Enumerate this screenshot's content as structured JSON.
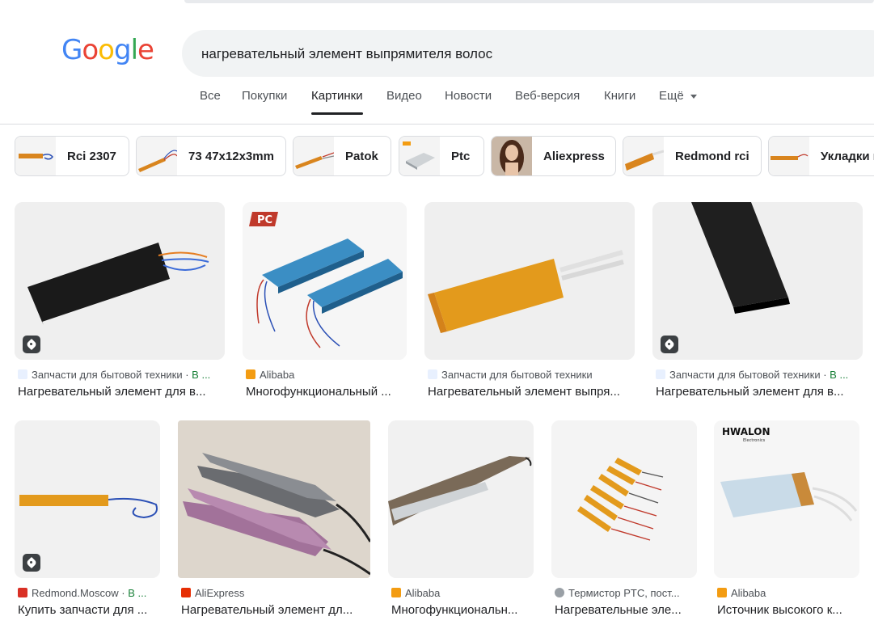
{
  "search": {
    "query": "нагревательный элемент выпрямителя волос"
  },
  "logo": {
    "letters": [
      "G",
      "o",
      "o",
      "g",
      "l",
      "e"
    ],
    "colors": [
      "#4285F4",
      "#EA4335",
      "#FBBC05",
      "#4285F4",
      "#34A853",
      "#EA4335"
    ]
  },
  "tabs": [
    {
      "label": "Все"
    },
    {
      "label": "Покупки"
    },
    {
      "label": "Картинки"
    },
    {
      "label": "Видео"
    },
    {
      "label": "Новости"
    },
    {
      "label": "Веб-версия"
    },
    {
      "label": "Книги"
    },
    {
      "label": "Ещё"
    }
  ],
  "chips": [
    {
      "label": "Rci 2307"
    },
    {
      "label": "73 47x12x3mm"
    },
    {
      "label": "Patok"
    },
    {
      "label": "Ptc"
    },
    {
      "label": "Aliexpress"
    },
    {
      "label": "Redmond rci"
    },
    {
      "label": "Укладки в"
    }
  ],
  "results": [
    {
      "source": "Запчасти для бытовой техники · ",
      "source_extra": "В ...",
      "title": "Нагревательный элемент для в...",
      "favicon": "zip-icon",
      "product_tag": true
    },
    {
      "source": "Alibaba",
      "source_extra": "",
      "title": "Многофункциональный ...",
      "favicon": "alibaba-icon",
      "product_tag": false
    },
    {
      "source": "Запчасти для бытовой техники",
      "source_extra": "",
      "title": "Нагревательный элемент выпря...",
      "favicon": "zip-icon",
      "product_tag": false
    },
    {
      "source": "Запчасти для бытовой техники · ",
      "source_extra": "В ...",
      "title": "Нагревательный элемент для в...",
      "favicon": "zip-icon",
      "product_tag": true
    },
    {
      "source": "Redmond.Moscow · ",
      "source_extra": "В ...",
      "title": "Купить запчасти для ...",
      "favicon": "redmond-icon",
      "product_tag": true
    },
    {
      "source": "AliExpress",
      "source_extra": "",
      "title": "Нагревательный элемент дл...",
      "favicon": "aliexpress-icon",
      "product_tag": false
    },
    {
      "source": "Alibaba",
      "source_extra": "",
      "title": "Многофункциональн...",
      "favicon": "alibaba-icon",
      "product_tag": false
    },
    {
      "source": "Термистор PTC, пост...",
      "source_extra": "",
      "title": "Нагревательные эле...",
      "favicon": "globe-icon",
      "product_tag": false
    },
    {
      "source": "Alibaba",
      "source_extra": "",
      "title": "Источник высокого к...",
      "favicon": "alibaba-icon",
      "product_tag": false
    }
  ],
  "image_text": {
    "logo_pc": "PC",
    "hwalon": "HWALON",
    "hwalon_sub": "Electronics"
  },
  "colors": {
    "accent": "#1a73e8",
    "green": "#188038"
  }
}
